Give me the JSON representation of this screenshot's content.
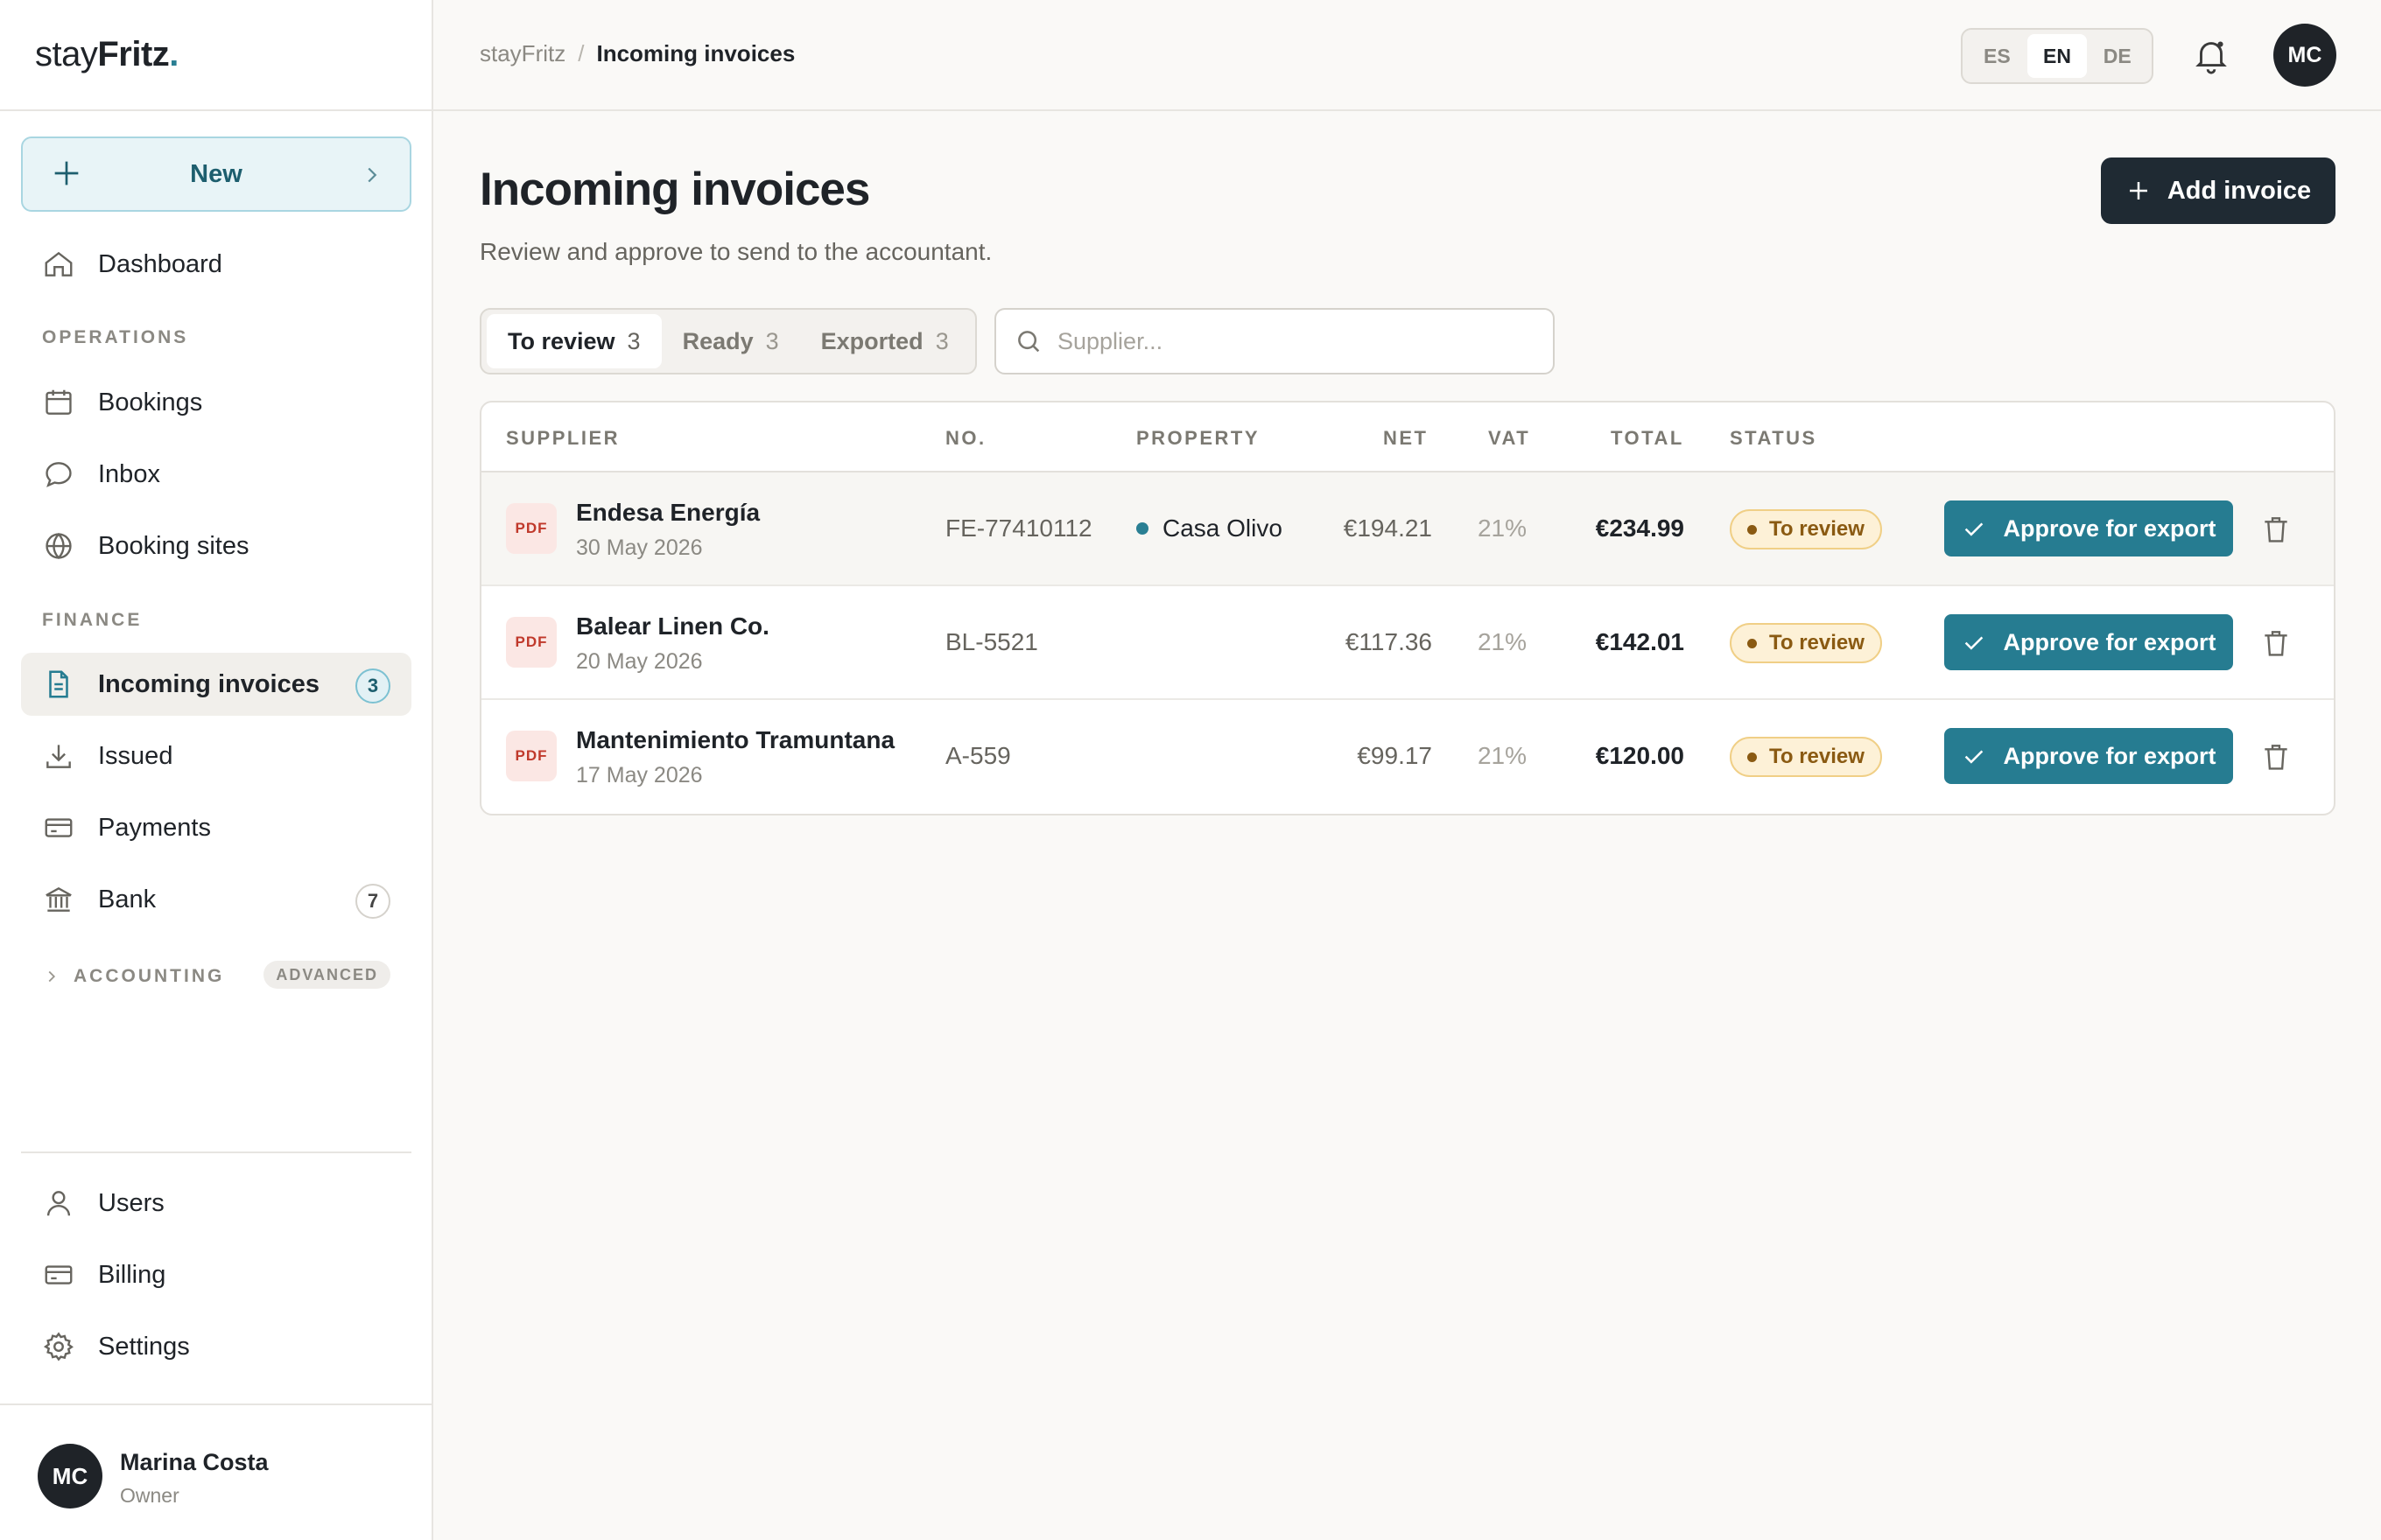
{
  "brand": {
    "name_light": "stay",
    "name_bold": "Fritz",
    "dot": "."
  },
  "sidebar": {
    "new_label": "New",
    "items": [
      {
        "label": "Dashboard"
      },
      {
        "label": "Bookings"
      },
      {
        "label": "Inbox"
      },
      {
        "label": "Booking sites"
      },
      {
        "label": "Incoming invoices",
        "count": "3"
      },
      {
        "label": "Issued"
      },
      {
        "label": "Payments"
      },
      {
        "label": "Bank",
        "count": "7"
      }
    ],
    "sections": {
      "operations": "OPERATIONS",
      "finance": "FINANCE"
    },
    "accounting": {
      "label": "ACCOUNTING",
      "badge": "ADVANCED"
    },
    "bottom_items": [
      {
        "label": "Users"
      },
      {
        "label": "Billing"
      },
      {
        "label": "Settings"
      }
    ],
    "user": {
      "initials": "MC",
      "name": "Marina Costa",
      "role": "Owner"
    }
  },
  "header": {
    "breadcrumb": {
      "root": "stayFritz",
      "separator": "/",
      "current": "Incoming invoices"
    },
    "languages": [
      "ES",
      "EN",
      "DE"
    ],
    "active_language": "EN",
    "avatar_initials": "MC"
  },
  "main": {
    "title": "Incoming invoices",
    "subtitle": "Review and approve to send to the accountant.",
    "add_label": "Add invoice",
    "tabs": [
      {
        "label": "To review",
        "count": "3"
      },
      {
        "label": "Ready",
        "count": "3"
      },
      {
        "label": "Exported",
        "count": "3"
      }
    ],
    "search_placeholder": "Supplier...",
    "columns": {
      "supplier": "SUPPLIER",
      "no": "NO.",
      "property": "PROPERTY",
      "net": "NET",
      "vat": "VAT",
      "total": "TOTAL",
      "status": "STATUS"
    },
    "rows": [
      {
        "file": "PDF",
        "supplier": "Endesa Energía",
        "date": "30 May 2026",
        "no": "FE-77410112",
        "property": "Casa Olivo",
        "net": "€194.21",
        "vat": "21%",
        "total": "€234.99",
        "status": "To review",
        "action": "Approve for export"
      },
      {
        "file": "PDF",
        "supplier": "Balear Linen Co.",
        "date": "20 May 2026",
        "no": "BL-5521",
        "property": "",
        "net": "€117.36",
        "vat": "21%",
        "total": "€142.01",
        "status": "To review",
        "action": "Approve for export"
      },
      {
        "file": "PDF",
        "supplier": "Mantenimiento Tramuntana",
        "date": "17 May 2026",
        "no": "A-559",
        "property": "",
        "net": "€99.17",
        "vat": "21%",
        "total": "€120.00",
        "status": "To review",
        "action": "Approve for export"
      }
    ]
  },
  "colors": {
    "accent": "#267c91",
    "dark": "#1f2a33",
    "badge_bg": "#fdf1d7",
    "badge_text": "#8a5a12"
  }
}
